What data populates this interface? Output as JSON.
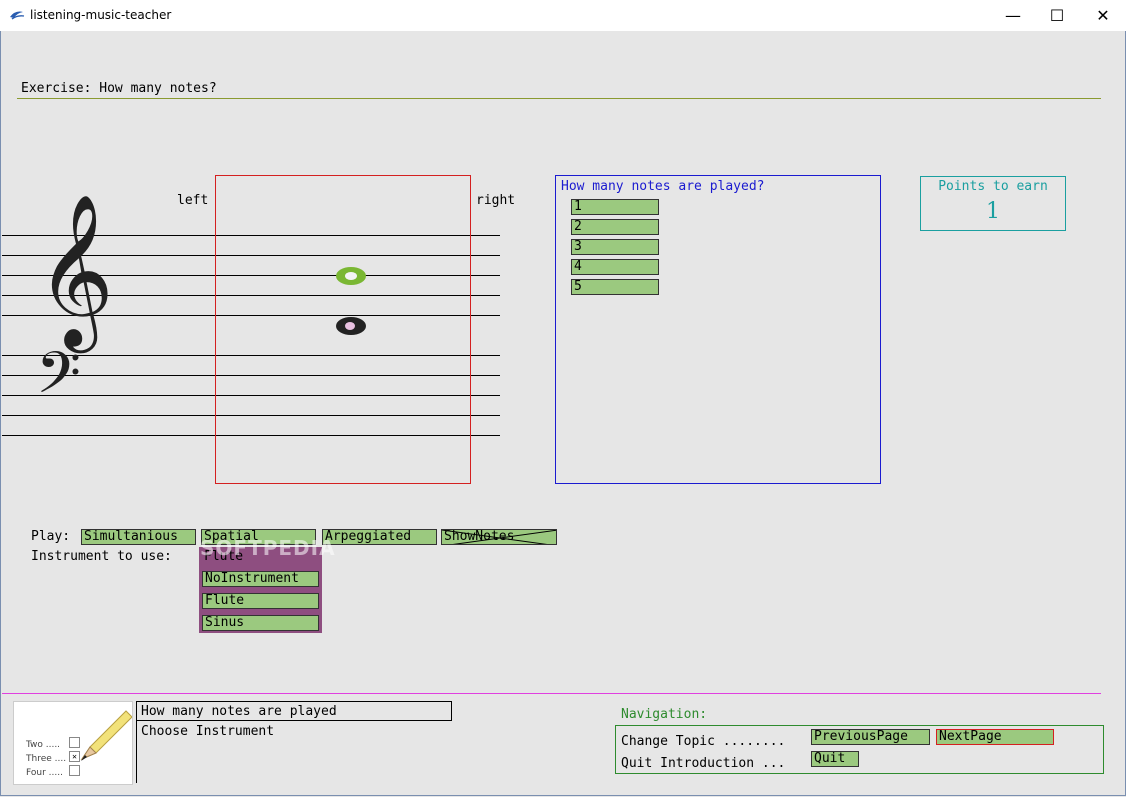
{
  "window": {
    "title": "listening-music-teacher",
    "min": "—",
    "max": "☐",
    "close": "✕"
  },
  "exercise": {
    "title": "Exercise: How many notes?"
  },
  "staff": {
    "left_label": "left",
    "right_label": "right"
  },
  "question": {
    "title": "How many notes are played?",
    "options": [
      "1",
      "2",
      "3",
      "4",
      "5"
    ]
  },
  "points": {
    "label": "Points to earn",
    "value": "1"
  },
  "play": {
    "label": "Play:",
    "buttons": [
      "Simultanious",
      "Spatial",
      "Arpeggiated",
      "ShowNotes"
    ]
  },
  "instrument": {
    "label": "Instrument to use:",
    "selected": "Flute",
    "options": [
      "NoInstrument",
      "Flute",
      "Sinus"
    ]
  },
  "watermark": "SOFTPEDIA",
  "checklist_image": {
    "items": [
      "Two",
      "Three",
      "Four"
    ]
  },
  "topics": {
    "items": [
      "How many notes are played",
      "Choose Instrument"
    ]
  },
  "navigation": {
    "title": "Navigation:",
    "change_topic": "Change Topic ........",
    "quit_intro": "Quit Introduction ...",
    "previous": "PreviousPage",
    "next": "NextPage",
    "quit": "Quit"
  },
  "colors": {
    "button_green": "#9bc97f",
    "question_border": "#1b1bd0",
    "staff_box_border": "#d42020",
    "points_teal": "#1a9fa0",
    "nav_green": "#2e8b2e",
    "divider_magenta": "#e040e0",
    "dropdown_purple": "#8e4e80"
  }
}
